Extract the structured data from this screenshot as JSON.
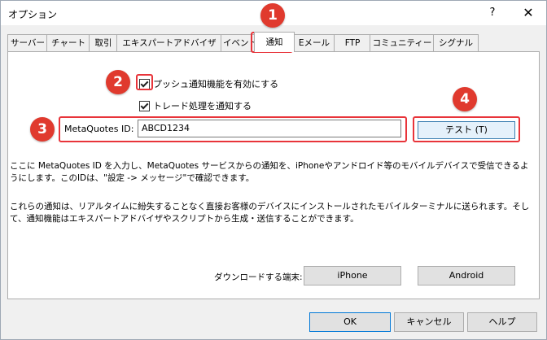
{
  "window": {
    "title": "オプション",
    "help_label": "?",
    "close_label": "✕"
  },
  "tabs": [
    {
      "label": "サーバー"
    },
    {
      "label": "チャート"
    },
    {
      "label": "取引"
    },
    {
      "label": "エキスパートアドバイザ"
    },
    {
      "label": "イベント"
    },
    {
      "label": "通知",
      "active": true
    },
    {
      "label": "Eメール"
    },
    {
      "label": "FTP"
    },
    {
      "label": "コミュニティー"
    },
    {
      "label": "シグナル"
    }
  ],
  "notifications": {
    "enable_push_label": "プッシュ通知機能を有効にする",
    "enable_push_checked": true,
    "notify_trades_label": "トレード処理を通知する",
    "notify_trades_checked": true,
    "metaquotes_id_label": "MetaQuotes ID:",
    "metaquotes_id_value": "ABCD1234",
    "test_button_label": "テスト (T)",
    "info_para1": "ここに MetaQuotes ID を入力し、MetaQuotes サービスからの通知を、iPhoneやアンドロイド等のモバイルデバイスで受信できるようにします。このIDは、\"設定 -> メッセージ\"で確認できます。",
    "info_para2": "これらの通知は、リアルタイムに紛失することなく直接お客様のデバイスにインストールされたモバイルターミナルに送られます。そして、通知機能はエキスパートアドバイザやスクリプトから生成・送信することができます。",
    "download_label": "ダウンロードする端末:",
    "iphone_label": "iPhone",
    "android_label": "Android"
  },
  "footer": {
    "ok_label": "OK",
    "cancel_label": "キャンセル",
    "help_label": "ヘルプ"
  },
  "annotations": {
    "badge1": "1",
    "badge2": "2",
    "badge3": "3",
    "badge4": "4",
    "color": "#e03a2e"
  }
}
